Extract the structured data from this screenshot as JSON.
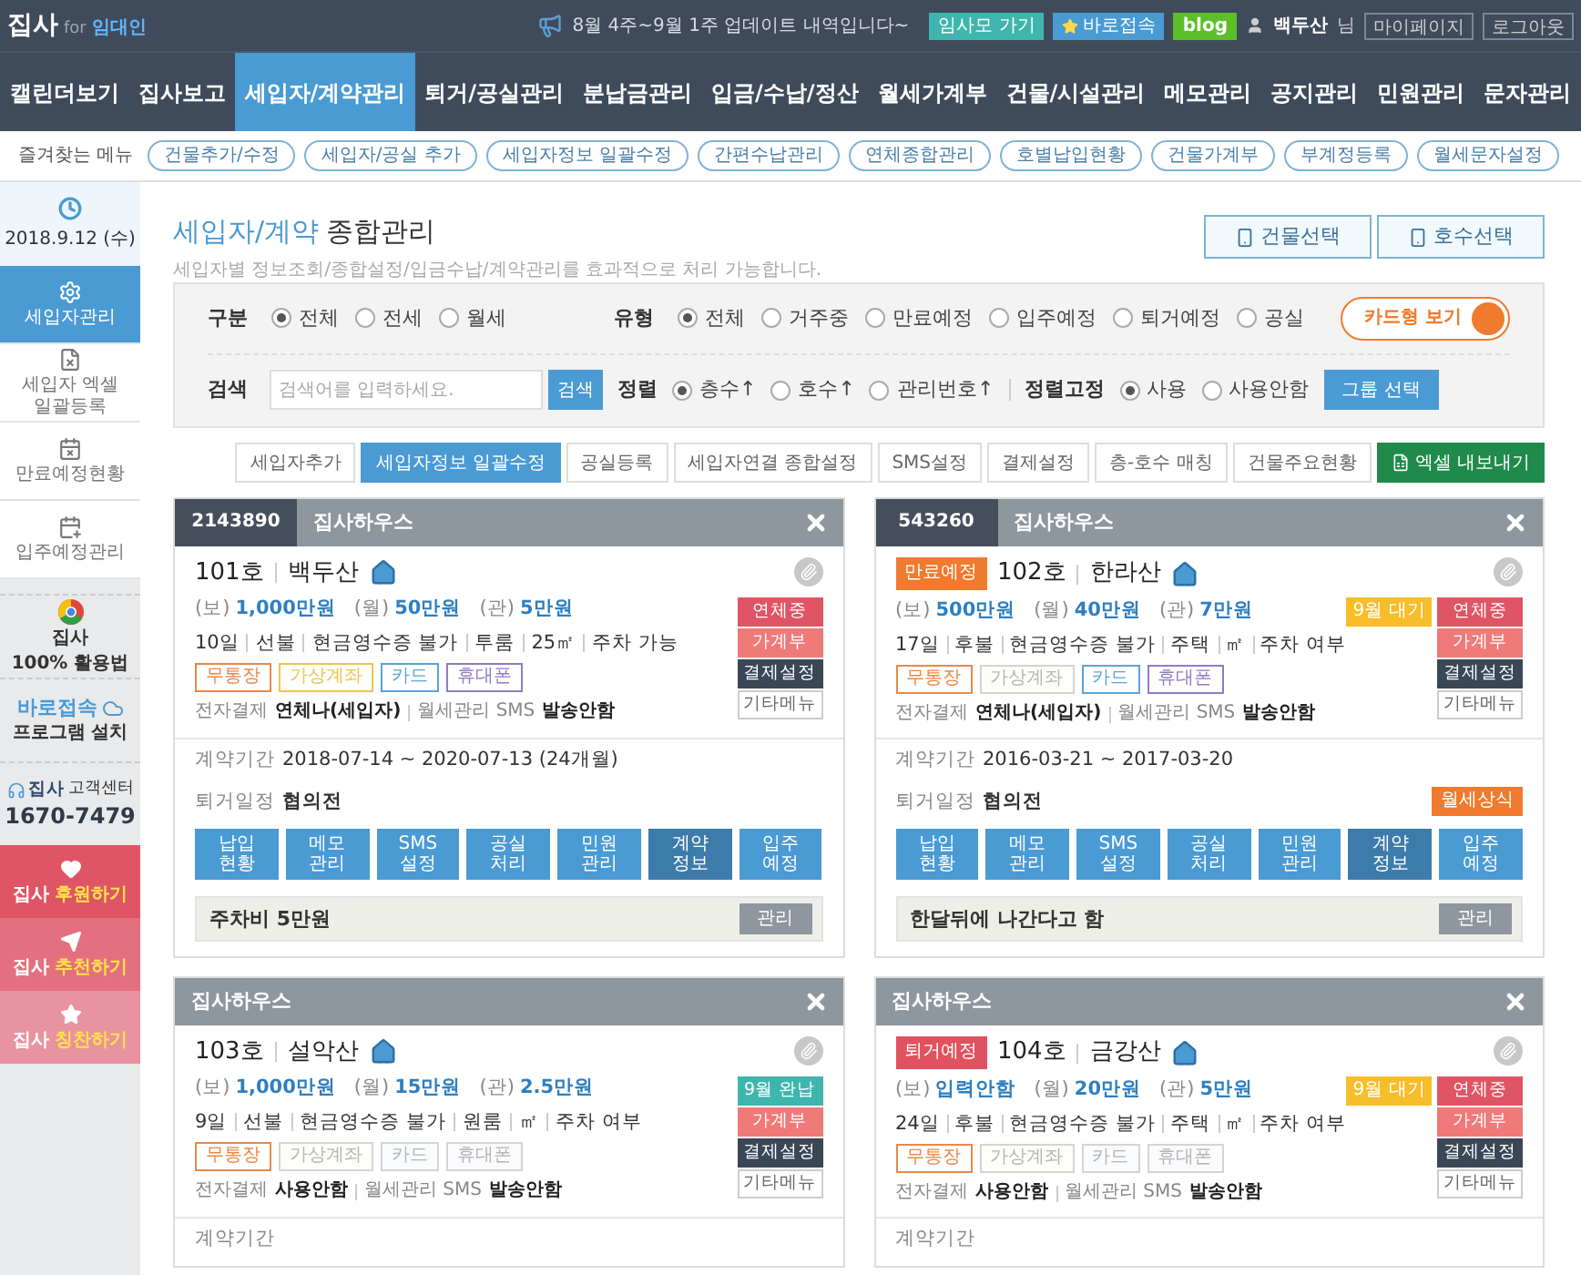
{
  "header": {
    "logo": "집사",
    "logo_for": "for",
    "logo_sub": "임대인",
    "notice": "8월 4주~9월 1주 업데이트 내역입니다~",
    "buttons": [
      {
        "label": "임사모 가기",
        "kind": "teal"
      },
      {
        "label": "바로접속",
        "kind": "quick"
      },
      {
        "label": "blog",
        "kind": "blog"
      }
    ],
    "user": "백두산",
    "user_suffix": "님",
    "links": [
      "마이페이지",
      "로그아웃"
    ]
  },
  "nav": [
    {
      "label": "캘린더보기",
      "selected": false
    },
    {
      "label": "집사보고",
      "selected": false
    },
    {
      "label": "세입자/계약관리",
      "selected": true
    },
    {
      "label": "퇴거/공실관리",
      "selected": false
    },
    {
      "label": "분납금관리",
      "selected": false
    },
    {
      "label": "입금/수납/정산",
      "selected": false
    },
    {
      "label": "월세가계부",
      "selected": false
    },
    {
      "label": "건물/시설관리",
      "selected": false
    },
    {
      "label": "메모관리",
      "selected": false
    },
    {
      "label": "공지관리",
      "selected": false
    },
    {
      "label": "민원관리",
      "selected": false
    },
    {
      "label": "문자관리",
      "selected": false
    }
  ],
  "favorites": {
    "label": "즐겨찾는 메뉴",
    "items": [
      "건물추가/수정",
      "세입자/공실 추가",
      "세입자정보 일괄수정",
      "간편수납관리",
      "연체종합관리",
      "호별납입현황",
      "건물가계부",
      "부계정등록",
      "월세문자설정"
    ]
  },
  "sidebar": {
    "date": "2018.9.12 (수)",
    "items": [
      {
        "label": "세입자관리",
        "kind": "gear",
        "selected": true
      },
      {
        "label": "세입자 엑셀\n일괄등록",
        "kind": "excel",
        "selected": false
      },
      {
        "label": "만료예정현황",
        "kind": "cal-x",
        "selected": false
      },
      {
        "label": "입주예정관리",
        "kind": "cal-plus",
        "selected": false
      }
    ],
    "promos": [
      {
        "kind": "guide",
        "line1": "집사",
        "line2": "100% 활용법"
      },
      {
        "kind": "install",
        "line1": "바로접속",
        "line2": "프로그램 설치"
      },
      {
        "kind": "support",
        "line1": "집사",
        "line1b": "고객센터",
        "line2": "1670-7479"
      }
    ],
    "actions": [
      {
        "prefix": "집사",
        "label": "후원하기",
        "kind": "heart"
      },
      {
        "prefix": "집사",
        "label": "추천하기",
        "kind": "send"
      },
      {
        "prefix": "집사",
        "label": "칭찬하기",
        "kind": "star"
      }
    ]
  },
  "page": {
    "title_highlight": "세입자/계약",
    "title_rest": "종합관리",
    "subtitle": "세입자별 정보조회/종합설정/입금수납/계약관리를 효과적으로 처리 가능합니다.",
    "buttons": [
      "건물선택",
      "호수선택"
    ]
  },
  "filters": {
    "groups": [
      {
        "label": "구분",
        "options": [
          {
            "label": "전체",
            "selected": true
          },
          {
            "label": "전세",
            "selected": false
          },
          {
            "label": "월세",
            "selected": false
          }
        ]
      },
      {
        "label": "유형",
        "options": [
          {
            "label": "전체",
            "selected": true
          },
          {
            "label": "거주중",
            "selected": false
          },
          {
            "label": "만료예정",
            "selected": false
          },
          {
            "label": "입주예정",
            "selected": false
          },
          {
            "label": "퇴거예정",
            "selected": false
          },
          {
            "label": "공실",
            "selected": false
          }
        ]
      }
    ],
    "view_toggle": {
      "label": "카드형 보기",
      "on": true
    },
    "search": {
      "label": "검색",
      "placeholder": "검색어를 입력하세요.",
      "button": "검색"
    },
    "sort": {
      "label": "정렬",
      "options": [
        {
          "label": "층수↑",
          "selected": true
        },
        {
          "label": "호수↑",
          "selected": false
        },
        {
          "label": "관리번호↑",
          "selected": false
        }
      ]
    },
    "sort_fix": {
      "label": "정렬고정",
      "options": [
        {
          "label": "사용",
          "selected": true
        },
        {
          "label": "사용안함",
          "selected": false
        }
      ]
    },
    "group_button": "그룹 선택"
  },
  "toolbar": [
    {
      "label": "세입자추가",
      "kind": "plain"
    },
    {
      "label": "세입자정보 일괄수정",
      "kind": "primary"
    },
    {
      "label": "공실등록",
      "kind": "plain"
    },
    {
      "label": "세입자연결 종합설정",
      "kind": "plain"
    },
    {
      "label": "SMS설정",
      "kind": "plain"
    },
    {
      "label": "결제설정",
      "kind": "plain"
    },
    {
      "label": "층-호수 매칭",
      "kind": "plain"
    },
    {
      "label": "건물주요현황",
      "kind": "plain"
    },
    {
      "label": "엑셀 내보내기",
      "kind": "excel"
    }
  ],
  "cards": [
    {
      "code": "2143890",
      "building": "집사하우스",
      "unit": "101호",
      "tenant": "백두산",
      "amounts": [
        {
          "prefix": "(보)",
          "value": "1,000만원"
        },
        {
          "prefix": "(월)",
          "value": "50만원"
        },
        {
          "prefix": "(관)",
          "value": "5만원"
        }
      ],
      "details": [
        "10일",
        "선불",
        "현금영수증 불가",
        "투룸",
        "25㎡",
        "주차 가능"
      ],
      "payments": [
        {
          "label": "무통장",
          "kind": "bank",
          "active": true
        },
        {
          "label": "가상계좌",
          "kind": "virtual",
          "active": true
        },
        {
          "label": "카드",
          "kind": "card",
          "active": true
        },
        {
          "label": "휴대폰",
          "kind": "phone",
          "active": true
        }
      ],
      "epay_label": "전자결제",
      "epay_value": "연체나(세입자)",
      "sms_label": "월세관리 SMS",
      "sms_value": "발송안함",
      "side_buttons": [
        {
          "label": "연체중",
          "kind": "overdue"
        },
        {
          "label": "가계부",
          "kind": "ledger"
        },
        {
          "label": "결제설정",
          "kind": "settings"
        },
        {
          "label": "기타메뉴",
          "kind": "more"
        }
      ],
      "contract_label": "계약기간",
      "contract_value": "2018-07-14 ~ 2020-07-13 (24개월)",
      "move_label": "퇴거일정",
      "move_value": "협의전",
      "actions": [
        {
          "label": "납입\n현황",
          "selected": false
        },
        {
          "label": "메모\n관리",
          "selected": false
        },
        {
          "label": "SMS\n설정",
          "selected": false
        },
        {
          "label": "공실\n처리",
          "selected": false
        },
        {
          "label": "민원\n관리",
          "selected": false
        },
        {
          "label": "계약\n정보",
          "selected": true
        },
        {
          "label": "입주\n예정",
          "selected": false
        }
      ],
      "memo": "주차비 5만원",
      "memo_button": "관리"
    },
    {
      "code": "543260",
      "building": "집사하우스",
      "tag": {
        "label": "만료예정",
        "color": "#f07a2e"
      },
      "unit": "102호",
      "tenant": "한라산",
      "amounts": [
        {
          "prefix": "(보)",
          "value": "500만원"
        },
        {
          "prefix": "(월)",
          "value": "40만원"
        },
        {
          "prefix": "(관)",
          "value": "7만원"
        }
      ],
      "details": [
        "17일",
        "후불",
        "현금영수증 불가",
        "주택",
        "㎡",
        "주차 여부"
      ],
      "payments": [
        {
          "label": "무통장",
          "kind": "bank",
          "active": true
        },
        {
          "label": "가상계좌",
          "kind": "virtual",
          "active": false
        },
        {
          "label": "카드",
          "kind": "card",
          "active": true
        },
        {
          "label": "휴대폰",
          "kind": "phone",
          "active": true
        }
      ],
      "epay_label": "전자결제",
      "epay_value": "연체나(세입자)",
      "sms_label": "월세관리 SMS",
      "sms_value": "발송안함",
      "status": {
        "label": "9월 대기",
        "color": "#f7bd2a"
      },
      "side_buttons": [
        {
          "label": "연체중",
          "kind": "overdue"
        },
        {
          "label": "가계부",
          "kind": "ledger"
        },
        {
          "label": "결제설정",
          "kind": "settings"
        },
        {
          "label": "기타메뉴",
          "kind": "more"
        }
      ],
      "contract_label": "계약기간",
      "contract_value": "2016-03-21 ~ 2017-03-20",
      "move_label": "퇴거일정",
      "move_value": "협의전",
      "move_button": "월세상식",
      "actions": [
        {
          "label": "납입\n현황",
          "selected": false
        },
        {
          "label": "메모\n관리",
          "selected": false
        },
        {
          "label": "SMS\n설정",
          "selected": false
        },
        {
          "label": "공실\n처리",
          "selected": false
        },
        {
          "label": "민원\n관리",
          "selected": false
        },
        {
          "label": "계약\n정보",
          "selected": true
        },
        {
          "label": "입주\n예정",
          "selected": false
        }
      ],
      "memo": "한달뒤에 나간다고 함",
      "memo_button": "관리"
    },
    {
      "building": "집사하우스",
      "unit": "103호",
      "tenant": "설악산",
      "amounts": [
        {
          "prefix": "(보)",
          "value": "1,000만원"
        },
        {
          "prefix": "(월)",
          "value": "15만원"
        },
        {
          "prefix": "(관)",
          "value": "2.5만원"
        }
      ],
      "details": [
        "9일",
        "선불",
        "현금영수증 불가",
        "원룸",
        "㎡",
        "주차 여부"
      ],
      "payments": [
        {
          "label": "무통장",
          "kind": "bank",
          "active": true
        },
        {
          "label": "가상계좌",
          "kind": "virtual",
          "active": false
        },
        {
          "label": "카드",
          "kind": "card",
          "active": false
        },
        {
          "label": "휴대폰",
          "kind": "phone",
          "active": false
        }
      ],
      "epay_label": "전자결제",
      "epay_value": "사용안함",
      "sms_label": "월세관리 SMS",
      "sms_value": "발송안함",
      "side_buttons": [
        {
          "label": "9월 완납",
          "kind": "paid"
        },
        {
          "label": "가계부",
          "kind": "ledger"
        },
        {
          "label": "결제설정",
          "kind": "settings"
        },
        {
          "label": "기타메뉴",
          "kind": "more"
        }
      ],
      "contract_label": "계약기간"
    },
    {
      "building": "집사하우스",
      "tag": {
        "label": "퇴거예정",
        "color": "#e0525f"
      },
      "unit": "104호",
      "tenant": "금강산",
      "amounts": [
        {
          "prefix": "(보)",
          "value": "입력안함"
        },
        {
          "prefix": "(월)",
          "value": "20만원"
        },
        {
          "prefix": "(관)",
          "value": "5만원"
        }
      ],
      "details": [
        "24일",
        "후불",
        "현금영수증 불가",
        "주택",
        "㎡",
        "주차 여부"
      ],
      "payments": [
        {
          "label": "무통장",
          "kind": "bank",
          "active": true
        },
        {
          "label": "가상계좌",
          "kind": "virtual",
          "active": false
        },
        {
          "label": "카드",
          "kind": "card",
          "active": false
        },
        {
          "label": "휴대폰",
          "kind": "phone",
          "active": false
        }
      ],
      "epay_label": "전자결제",
      "epay_value": "사용안함",
      "sms_label": "월세관리 SMS",
      "sms_value": "발송안함",
      "status": {
        "label": "9월 대기",
        "color": "#f7bd2a"
      },
      "side_buttons": [
        {
          "label": "연체중",
          "kind": "overdue"
        },
        {
          "label": "가계부",
          "kind": "ledger"
        },
        {
          "label": "결제설정",
          "kind": "settings"
        },
        {
          "label": "기타메뉴",
          "kind": "more"
        }
      ],
      "contract_label": "계약기간"
    }
  ]
}
